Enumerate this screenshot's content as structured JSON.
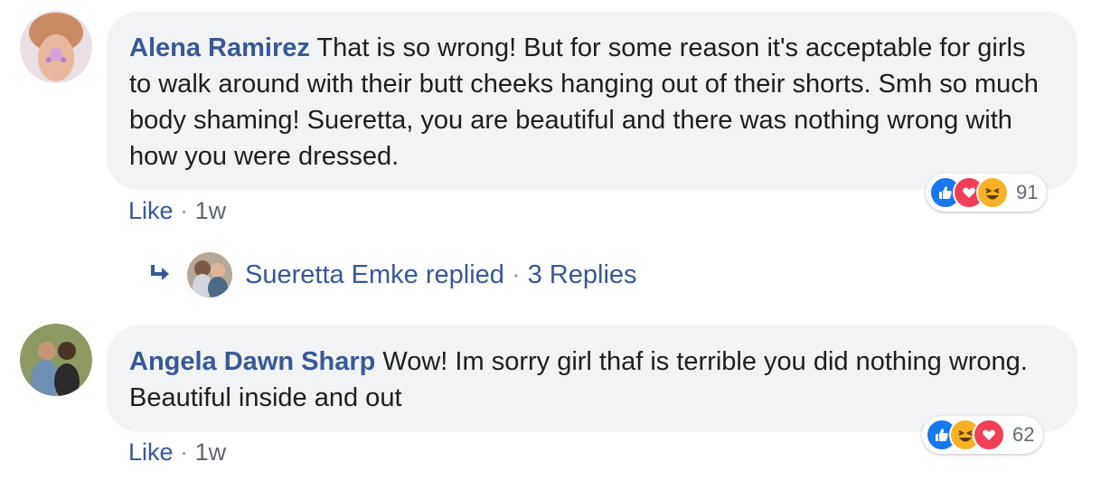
{
  "comments": [
    {
      "author": "Alena Ramirez",
      "text": "That is so wrong! But for some reason it's acceptable for girls to walk around with their butt cheeks hanging out of their shorts. Smh so much body shaming! Sueretta, you are beautiful and there was nothing wrong with how you were dressed.",
      "like_label": "Like",
      "separator": "·",
      "time": "1w",
      "reaction_count": "91",
      "reactions": [
        "like-icon",
        "love-icon",
        "haha-icon"
      ]
    },
    {
      "author": "Angela Dawn Sharp",
      "text": "Wow! Im sorry girl thaf is terrible you did nothing wrong. Beautiful inside and out",
      "like_label": "Like",
      "separator": "·",
      "time": "1w",
      "reaction_count": "62",
      "reactions": [
        "like-icon",
        "haha-icon",
        "love-icon"
      ]
    }
  ],
  "reply_summary": {
    "name": "Sueretta Emke replied",
    "separator": "·",
    "count_label": "3 Replies"
  },
  "colors": {
    "link": "#385898",
    "bubble": "#f2f3f5",
    "like": "#1877f2",
    "love": "#f33e58",
    "haha": "#f7b125"
  }
}
